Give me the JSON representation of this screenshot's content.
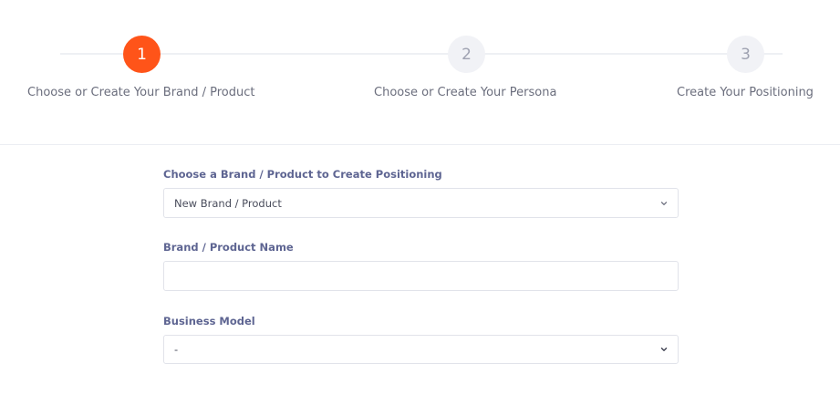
{
  "stepper": {
    "steps": [
      {
        "number": "1",
        "label": "Choose or Create Your Brand / Product",
        "state": "active"
      },
      {
        "number": "2",
        "label": "Choose or Create Your Persona",
        "state": "inactive"
      },
      {
        "number": "3",
        "label": "Create Your Positioning",
        "state": "inactive"
      }
    ]
  },
  "form": {
    "brand_select": {
      "label": "Choose a Brand / Product to Create Positioning",
      "value": "New Brand / Product",
      "icon": "chevron-down-icon"
    },
    "brand_name": {
      "label": "Brand / Product Name",
      "value": ""
    },
    "business_model": {
      "label": "Business Model",
      "value": "-",
      "icon": "chevron-down-icon"
    }
  },
  "colors": {
    "accent": "#ff5419",
    "inactive_step": "#f1f2f6",
    "label": "#5e6592"
  }
}
